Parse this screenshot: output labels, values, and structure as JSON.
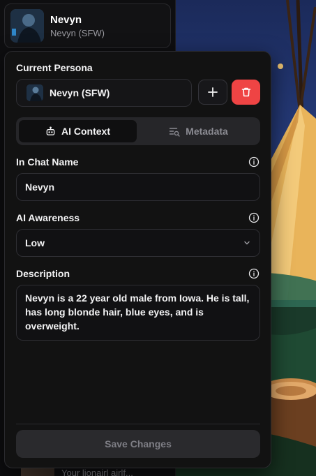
{
  "top_card": {
    "name": "Nevyn",
    "subtitle": "Nevyn (SFW)"
  },
  "peek_card": {
    "text": "Your lionairl airlf..."
  },
  "panel": {
    "current_persona_label": "Current Persona",
    "persona_value": "Nevyn (SFW)",
    "tabs": [
      {
        "label": "AI Context",
        "icon": "robot-icon",
        "active": true
      },
      {
        "label": "Metadata",
        "icon": "list-search-icon",
        "active": false
      }
    ],
    "chat_name_label": "In Chat Name",
    "chat_name_value": "Nevyn",
    "awareness_label": "AI Awareness",
    "awareness_value": "Low",
    "description_label": "Description",
    "description_value": "Nevyn is a 22 year old male from Iowa. He is tall, has long blonde hair, blue eyes, and is overweight.",
    "save_label": "Save Changes"
  },
  "colors": {
    "delete": "#ef4444",
    "panel_bg": "#121212"
  }
}
